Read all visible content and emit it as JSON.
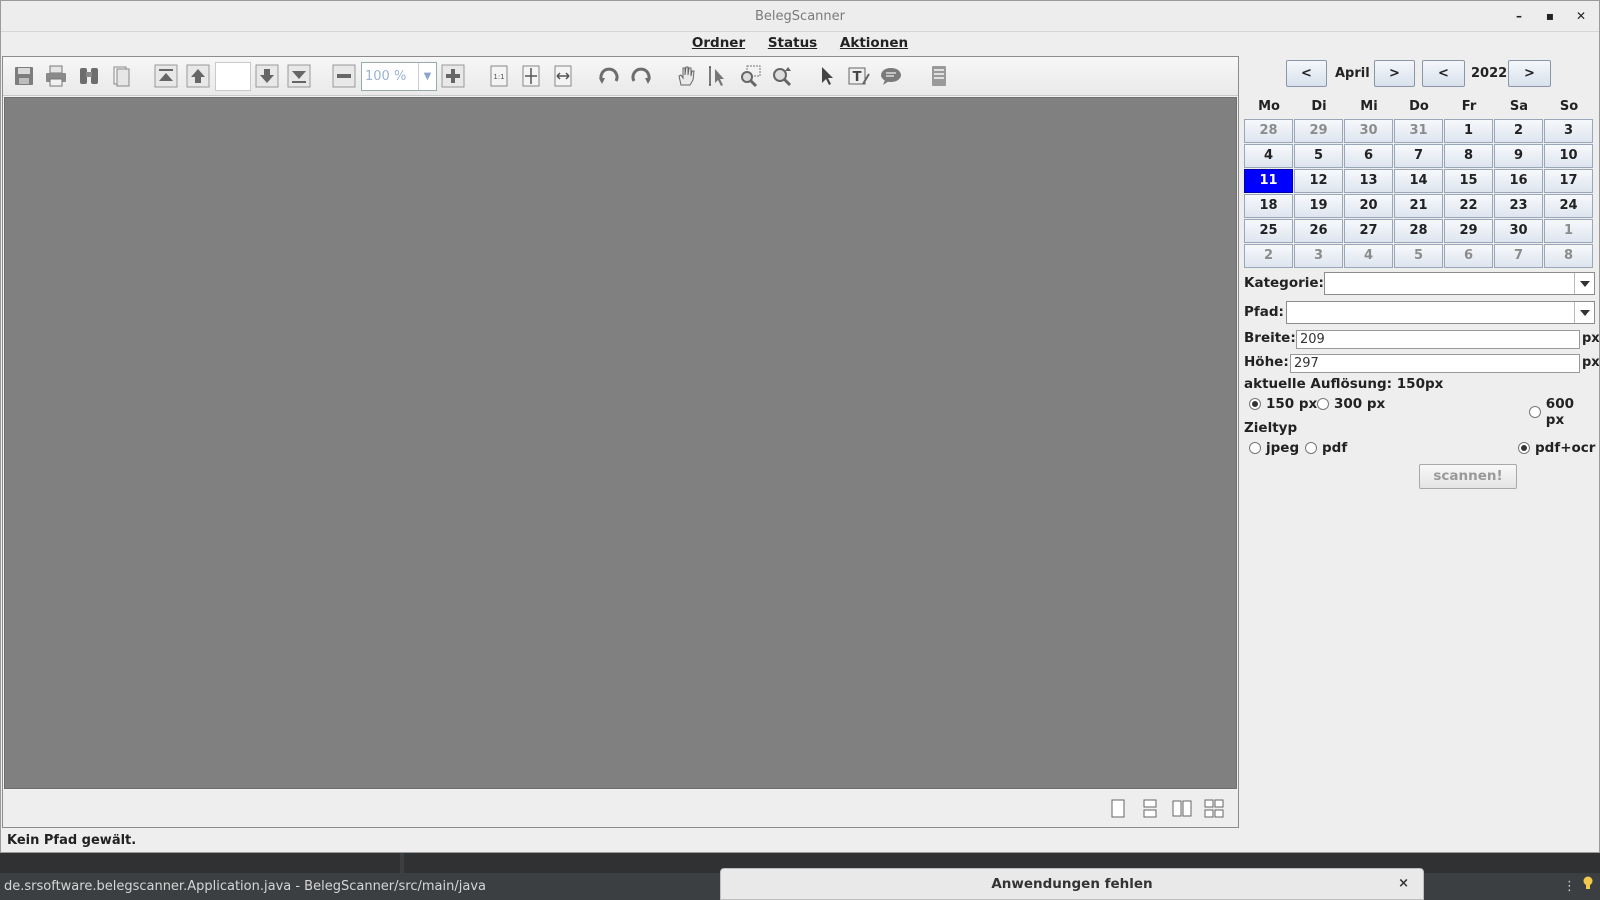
{
  "window": {
    "title": "BelegScanner",
    "controls": {
      "minimize": "–",
      "maximize": "▪",
      "close": "✕"
    }
  },
  "menu": [
    "Ordner",
    "Status",
    "Aktionen"
  ],
  "viewer": {
    "page_value": "",
    "zoom_value": "100 %",
    "toolbar_icons": [
      "save-icon",
      "print-icon",
      "search-icon",
      "page-thumbnails-icon",
      "first-page-icon",
      "previous-page-icon",
      "next-page-icon",
      "last-page-icon",
      "zoom-out-icon",
      "zoom-in-icon",
      "actual-size-icon",
      "fit-page-icon",
      "fit-width-icon",
      "rotate-left-icon",
      "rotate-right-icon",
      "pan-tool-icon",
      "text-select-icon",
      "zoom-select-icon",
      "zoom-dynamic-icon",
      "select-icon",
      "free-text-annotation-icon",
      "comment-annotation-icon",
      "properties-icon"
    ],
    "footer_icons": [
      "single-page-icon",
      "single-page-continuous-icon",
      "two-pages-icon",
      "two-pages-continuous-icon"
    ]
  },
  "status_message": "Kein Pfad gewält.",
  "calendar": {
    "month_prev": "<",
    "month": "April",
    "month_next": ">",
    "year_prev": "<",
    "year": "2022",
    "year_next": ">",
    "weekdays": [
      "Mo",
      "Di",
      "Mi",
      "Do",
      "Fr",
      "Sa",
      "So"
    ],
    "weeks": [
      [
        {
          "d": "28",
          "o": true
        },
        {
          "d": "29",
          "o": true
        },
        {
          "d": "30",
          "o": true
        },
        {
          "d": "31",
          "o": true
        },
        {
          "d": "1"
        },
        {
          "d": "2"
        },
        {
          "d": "3"
        }
      ],
      [
        {
          "d": "4"
        },
        {
          "d": "5"
        },
        {
          "d": "6"
        },
        {
          "d": "7"
        },
        {
          "d": "8"
        },
        {
          "d": "9"
        },
        {
          "d": "10"
        }
      ],
      [
        {
          "d": "11",
          "s": true
        },
        {
          "d": "12"
        },
        {
          "d": "13"
        },
        {
          "d": "14"
        },
        {
          "d": "15"
        },
        {
          "d": "16"
        },
        {
          "d": "17"
        }
      ],
      [
        {
          "d": "18"
        },
        {
          "d": "19"
        },
        {
          "d": "20"
        },
        {
          "d": "21"
        },
        {
          "d": "22"
        },
        {
          "d": "23"
        },
        {
          "d": "24"
        }
      ],
      [
        {
          "d": "25"
        },
        {
          "d": "26"
        },
        {
          "d": "27"
        },
        {
          "d": "28"
        },
        {
          "d": "29"
        },
        {
          "d": "30"
        },
        {
          "d": "1",
          "o": true
        }
      ],
      [
        {
          "d": "2",
          "o": true
        },
        {
          "d": "3",
          "o": true
        },
        {
          "d": "4",
          "o": true
        },
        {
          "d": "5",
          "o": true
        },
        {
          "d": "6",
          "o": true
        },
        {
          "d": "7",
          "o": true
        },
        {
          "d": "8",
          "o": true
        }
      ]
    ],
    "selected_color": "#0000ff"
  },
  "form": {
    "kategorie_label": "Kategorie:",
    "kategorie_value": "",
    "pfad_label": "Pfad:",
    "pfad_value": "",
    "breite_label": "Breite:",
    "breite_value": "209",
    "breite_unit": "px",
    "hoehe_label": "Höhe:",
    "hoehe_value": "297",
    "hoehe_unit": "px",
    "aufloesung_label": "aktuelle Auflösung: 150px",
    "resolutions": [
      {
        "label": "150 px",
        "checked": true
      },
      {
        "label": "300 px",
        "checked": false
      },
      {
        "label": "600 px",
        "checked": false
      }
    ],
    "zieltyp_label": "Zieltyp",
    "targets": [
      {
        "label": "jpeg",
        "checked": false
      },
      {
        "label": "pdf",
        "checked": false
      },
      {
        "label": "pdf+ocr",
        "checked": true
      }
    ],
    "scan_button": "scannen!"
  },
  "ide": {
    "status_path": "de.srsoftware.belegscanner.Application.java - BelegScanner/src/main/java",
    "notification": "Anwendungen fehlen",
    "notification_close": "×",
    "menu_dots": "⋮",
    "bulb_icon": "lightbulb-icon"
  }
}
